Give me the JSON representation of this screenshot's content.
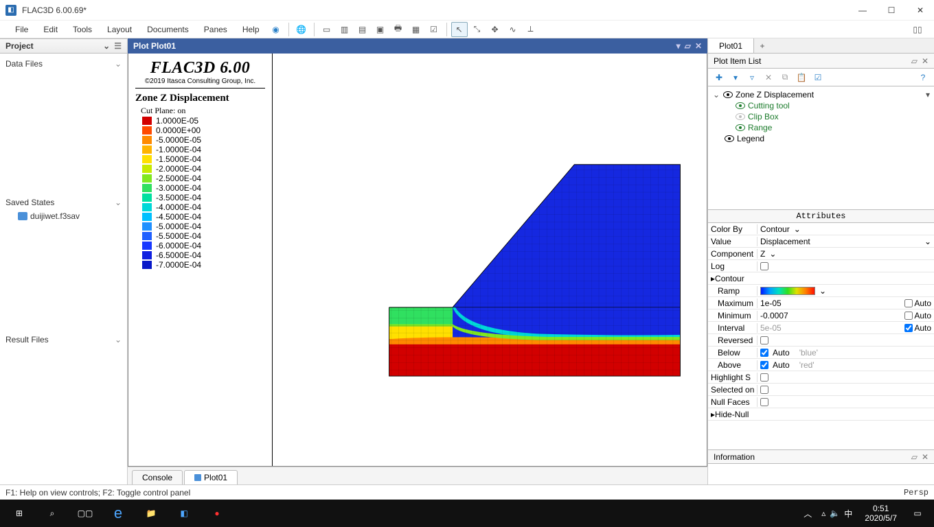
{
  "titlebar": {
    "title": "FLAC3D 6.00.69*"
  },
  "menubar": {
    "items": [
      "File",
      "Edit",
      "Tools",
      "Layout",
      "Documents",
      "Panes",
      "Help"
    ]
  },
  "left": {
    "header": "Project",
    "sections": {
      "data_files": "Data Files",
      "saved_states": "Saved States",
      "saved_file": "duijiwet.f3sav",
      "result_files": "Result Files"
    }
  },
  "plot": {
    "title": "Plot Plot01",
    "legend_title": "FLAC3D 6.00",
    "copyright": "©2019 Itasca Consulting Group, Inc.",
    "heading": "Zone Z Displacement",
    "note": "Cut Plane: on",
    "entries": [
      {
        "c": "#d20000",
        "v": "1.0000E-05"
      },
      {
        "c": "#ff4a00",
        "v": "0.0000E+00"
      },
      {
        "c": "#ff8a00",
        "v": "-5.0000E-05"
      },
      {
        "c": "#ffb400",
        "v": "-1.0000E-04"
      },
      {
        "c": "#ffe000",
        "v": "-1.5000E-04"
      },
      {
        "c": "#c8ea00",
        "v": "-2.0000E-04"
      },
      {
        "c": "#80e820",
        "v": "-2.5000E-04"
      },
      {
        "c": "#30e060",
        "v": "-3.0000E-04"
      },
      {
        "c": "#00e0a0",
        "v": "-3.5000E-04"
      },
      {
        "c": "#00d8d8",
        "v": "-4.0000E-04"
      },
      {
        "c": "#00c0ff",
        "v": "-4.5000E-04"
      },
      {
        "c": "#2090ff",
        "v": "-5.0000E-04"
      },
      {
        "c": "#2060ff",
        "v": "-5.5000E-04"
      },
      {
        "c": "#1838ff",
        "v": "-6.0000E-04"
      },
      {
        "c": "#1020e0",
        "v": "-6.5000E-04"
      },
      {
        "c": "#0818c8",
        "v": "-7.0000E-04"
      }
    ]
  },
  "bottom_tabs": {
    "console": "Console",
    "plot": "Plot01"
  },
  "right": {
    "tab": "Plot01",
    "list_header": "Plot Item List",
    "tree": {
      "root": "Zone Z Displacement",
      "children": [
        "Cutting tool",
        "Clip Box",
        "Range"
      ],
      "sibling": "Legend"
    },
    "attr_header": "Attributes",
    "attrs": {
      "color_by_l": "Color By",
      "color_by_v": "Contour",
      "value_l": "Value",
      "value_v": "Displacement",
      "component_l": "Component",
      "component_v": "Z",
      "log_l": "Log",
      "contour_l": "Contour",
      "ramp_l": "Ramp",
      "max_l": "Maximum",
      "max_v": "1e-05",
      "auto": "Auto",
      "min_l": "Minimum",
      "min_v": "-0.0007",
      "interval_l": "Interval",
      "interval_v": "5e-05",
      "reversed_l": "Reversed",
      "below_l": "Below",
      "below_v": "'blue'",
      "above_l": "Above",
      "above_v": "'red'",
      "highlight_l": "Highlight S",
      "selected_l": "Selected on",
      "null_l": "Null Faces",
      "hide_l": "Hide-Null"
    },
    "info_header": "Information"
  },
  "statusbar": {
    "left": "F1: Help on view controls; F2: Toggle control panel",
    "right": "Persp"
  },
  "taskbar": {
    "time": "0:51",
    "date": "2020/5/7"
  }
}
